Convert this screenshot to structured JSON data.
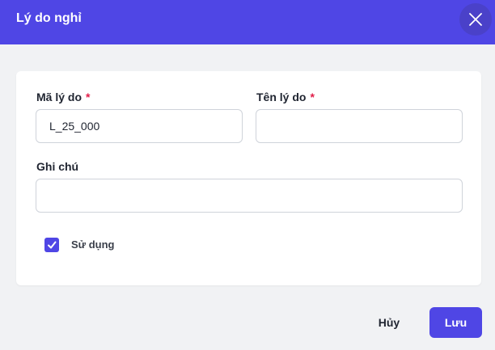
{
  "dialog": {
    "title": "Lý do nghỉ",
    "close_icon": "close-icon"
  },
  "form": {
    "code_label": "Mã lý do",
    "code_value": "L_25_000",
    "name_label": "Tên lý do",
    "name_value": "",
    "note_label": "Ghi chú",
    "note_value": "",
    "required_mark": "*",
    "active_label": "Sử dụng",
    "active_checked": true
  },
  "footer": {
    "cancel_label": "Hủy",
    "save_label": "Lưu"
  },
  "colors": {
    "primary": "#4f46e5",
    "required": "#e11d48"
  }
}
